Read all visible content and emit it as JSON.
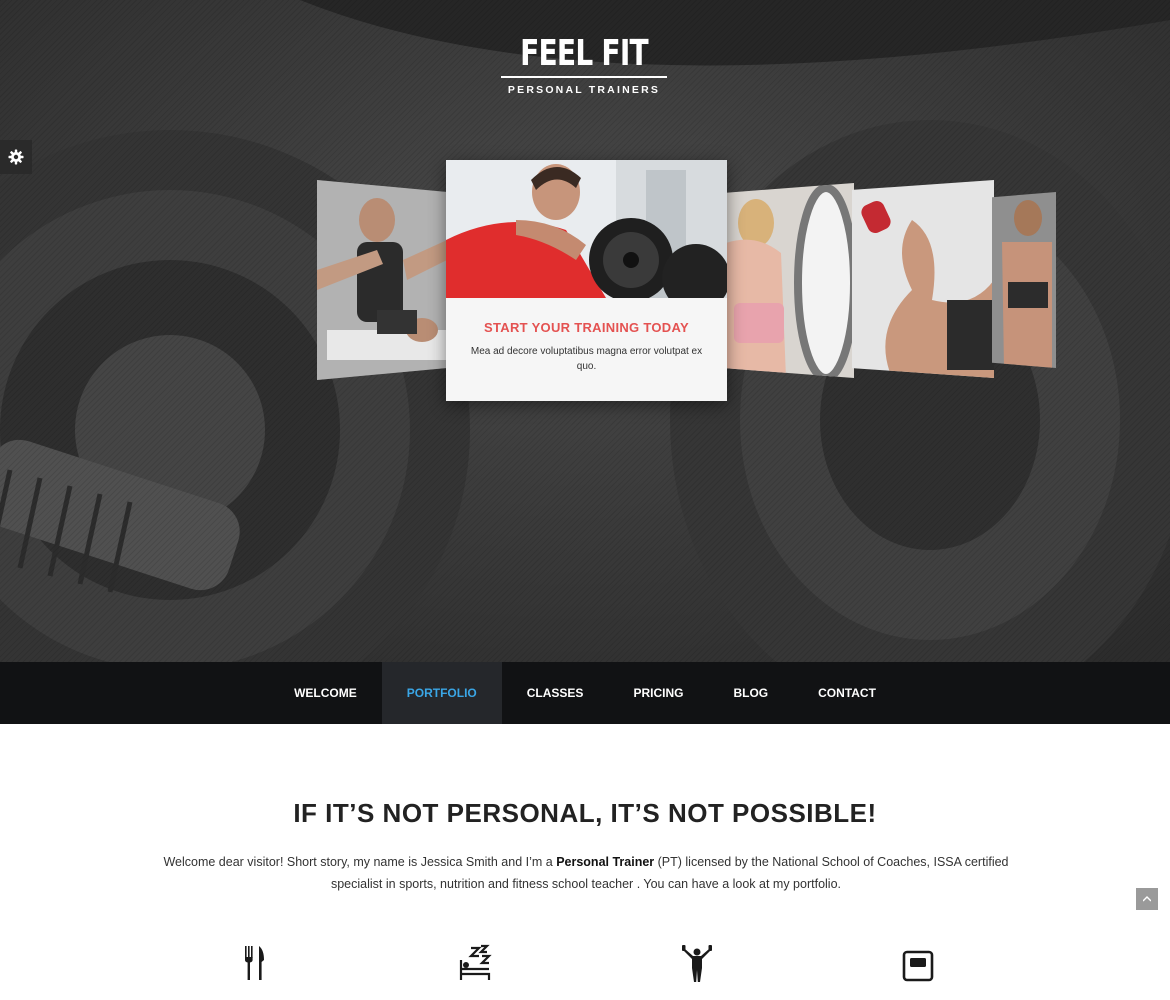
{
  "logo": {
    "title": "FEEL FIT",
    "subtitle": "PERSONAL TRAINERS"
  },
  "settings": {
    "icon": "gear-icon"
  },
  "slider": {
    "active_slide": {
      "title": "START YOUR TRAINING TODAY",
      "text": "Mea ad decore voluptatibus magna error volutpat ex quo."
    },
    "slides": [
      {
        "icon": "trainer-photo"
      },
      {
        "icon": "athlete-barbell-photo"
      },
      {
        "icon": "woman-training-photo"
      },
      {
        "icon": "dumbbell-arm-photo"
      },
      {
        "icon": "woman-fitness-photo"
      }
    ]
  },
  "nav": {
    "items": [
      {
        "label": "WELCOME"
      },
      {
        "label": "PORTFOLIO",
        "active": true
      },
      {
        "label": "CLASSES"
      },
      {
        "label": "PRICING"
      },
      {
        "label": "BLOG"
      },
      {
        "label": "CONTACT"
      }
    ]
  },
  "main": {
    "headline": "IF IT’S NOT PERSONAL, IT’S NOT POSSIBLE!",
    "intro_part1": "Welcome dear visitor! Short story, my name is Jessica Smith and I’m a ",
    "intro_bold": "Personal Trainer",
    "intro_part2": " (PT) licensed by the National School of Coaches, ISSA certified specialist in sports, nutrition and fitness school teacher . You can have a look at my portfolio.",
    "features": [
      {
        "icon": "fork-knife-icon"
      },
      {
        "icon": "sleep-bed-icon"
      },
      {
        "icon": "exercise-person-icon"
      },
      {
        "icon": "scale-icon"
      }
    ]
  },
  "scroll_top": {
    "icon": "chevron-up-icon"
  },
  "colors": {
    "accent": "#e45251",
    "nav_active": "#3aa6e6",
    "nav_bg": "#111214"
  }
}
